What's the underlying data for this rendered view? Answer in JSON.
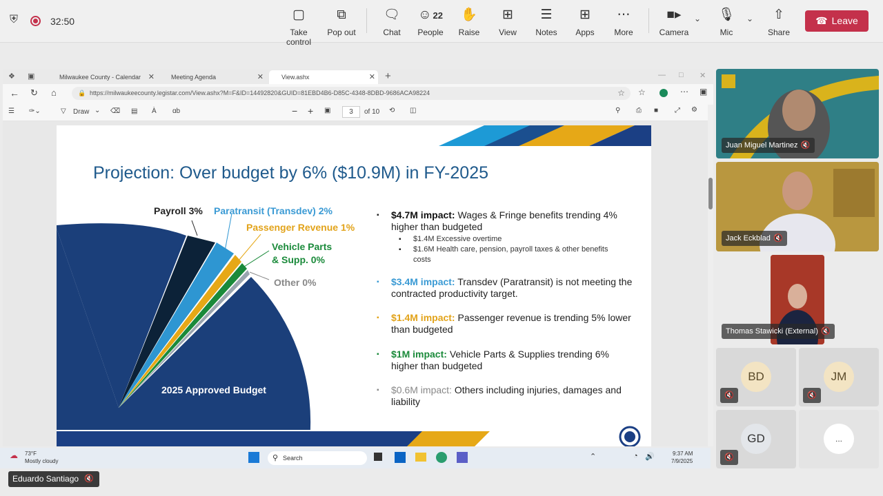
{
  "meeting": {
    "timer": "32:50",
    "toolbar": [
      {
        "label": "Take control",
        "icon": "take-control-icon"
      },
      {
        "label": "Pop out",
        "icon": "pop-out-icon"
      },
      {
        "label": "Chat",
        "icon": "chat-icon"
      },
      {
        "label": "People",
        "icon": "people-icon",
        "count": "22"
      },
      {
        "label": "Raise",
        "icon": "raise-hand-icon"
      },
      {
        "label": "View",
        "icon": "view-icon"
      },
      {
        "label": "Notes",
        "icon": "notes-icon"
      },
      {
        "label": "Apps",
        "icon": "apps-icon"
      },
      {
        "label": "More",
        "icon": "more-icon"
      },
      {
        "label": "Camera",
        "icon": "camera-icon"
      },
      {
        "label": "Mic",
        "icon": "mic-icon"
      },
      {
        "label": "Share",
        "icon": "share-icon"
      }
    ],
    "leave_label": "Leave",
    "leave_color": "#c4314b"
  },
  "browser": {
    "tabs": [
      {
        "title": "Milwaukee County - Calendar"
      },
      {
        "title": "Meeting Agenda"
      },
      {
        "title": "View.ashx"
      }
    ],
    "url": "https://milwaukeecounty.legistar.com/View.ashx?M=F&ID=14492820&GUID=81EBD4B6-D85C-4348-8DBD-9686ACA98224",
    "pdf_toolbar": {
      "draw_label": "Draw",
      "page_current": "3",
      "page_total": "of 10"
    }
  },
  "slide": {
    "title": "Projection: Over budget by 6% ($10.9M) in FY-2025",
    "pie_labels": [
      {
        "text": "Payroll 3%",
        "color": "#222222"
      },
      {
        "text": "Paratransit (Transdev) 2%",
        "color": "#3a9ad4"
      },
      {
        "text": "Passenger Revenue 1%",
        "color": "#e2a31a"
      },
      {
        "text": "Vehicle Parts",
        "color": "#1a8a3a"
      },
      {
        "text": "& Supp. 0%",
        "color": "#1a8a3a"
      },
      {
        "text": "Other 0%",
        "color": "#888888"
      }
    ],
    "pie_center_label": "2025 Approved Budget",
    "bullets": [
      {
        "lead": "$4.7M impact:",
        "lead_color": "#111111",
        "text": "Wages & Fringe benefits trending 4% higher than budgeted"
      },
      {
        "lead": "$3.4M impact:",
        "lead_color": "#3a9ad4",
        "text": "Transdev (Paratransit) is not meeting the contracted productivity target."
      },
      {
        "lead": "$1.4M impact:",
        "lead_color": "#e2a31a",
        "text": "Passenger revenue is trending 5% lower than budgeted"
      },
      {
        "lead": "$1M impact:",
        "lead_color": "#1a8a3a",
        "text": "Vehicle Parts & Supplies trending 6% higher than budgeted"
      },
      {
        "lead": "$0.6M impact:",
        "lead_color": "#888888",
        "text": "Others including injuries, damages and liability"
      }
    ],
    "sub_bullets": [
      "$1.4M Excessive overtime",
      "$1.6M Health care, pension, payroll taxes & other benefits costs"
    ]
  },
  "participants": [
    {
      "name": "Juan Miguel Martinez"
    },
    {
      "name": "Jack Eckblad"
    },
    {
      "name": "Thomas Stawicki (External)"
    },
    {
      "initials": "BD"
    },
    {
      "initials": "JM"
    },
    {
      "initials": "GD"
    },
    {
      "overflow": "..."
    }
  ],
  "taskbar": {
    "temp": "73°F",
    "weather": "Mostly cloudy",
    "search": "Search",
    "time": "9:37 AM",
    "date": "7/9/2025"
  },
  "self_view": {
    "name": "Eduardo Santiago"
  }
}
